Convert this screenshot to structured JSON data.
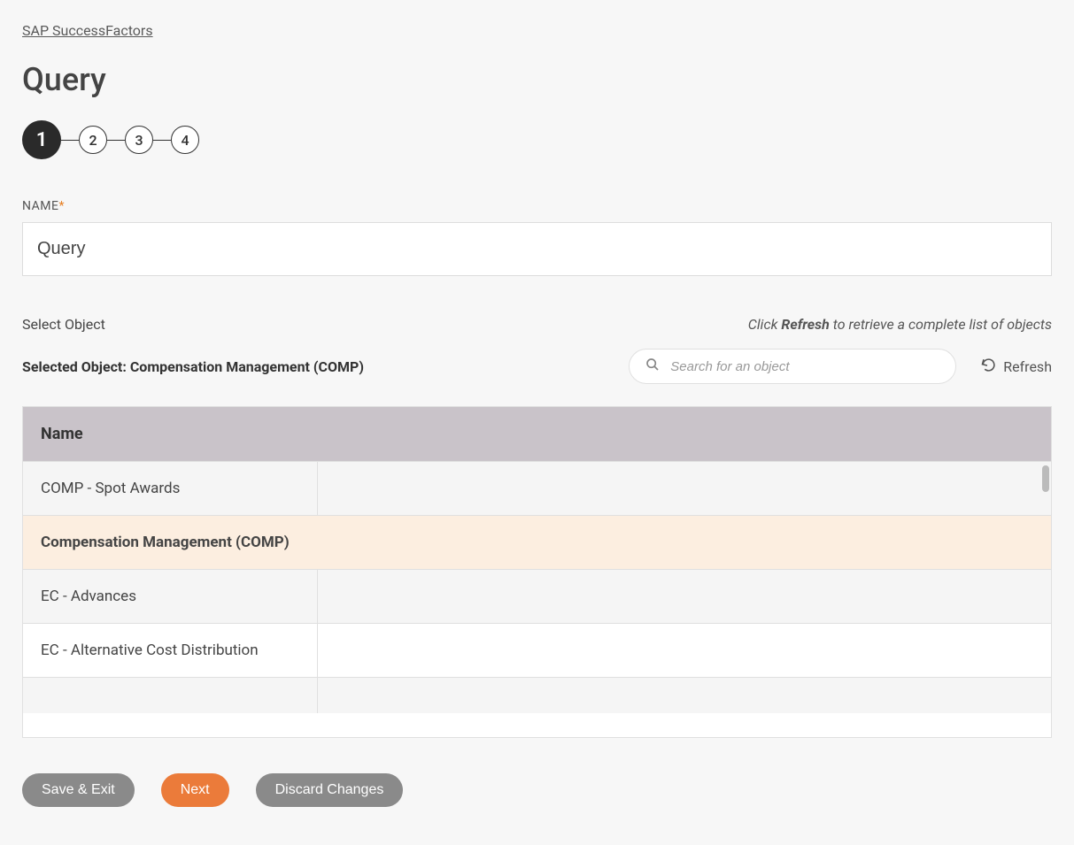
{
  "breadcrumb": "SAP SuccessFactors",
  "page_title": "Query",
  "stepper": {
    "steps": [
      "1",
      "2",
      "3",
      "4"
    ],
    "active_index": 0
  },
  "name_field": {
    "label": "NAME",
    "required_marker": "*",
    "value": "Query"
  },
  "select_object": {
    "label": "Select Object",
    "hint_prefix": "Click ",
    "hint_bold": "Refresh",
    "hint_suffix": " to retrieve a complete list of objects"
  },
  "selected_object": {
    "prefix": "Selected Object: ",
    "value": "Compensation Management (COMP)"
  },
  "search": {
    "placeholder": "Search for an object"
  },
  "refresh_label": "Refresh",
  "table": {
    "header": "Name",
    "rows": [
      {
        "name": "COMP - Spot Awards",
        "alt": true,
        "selected": false
      },
      {
        "name": "Compensation Management (COMP)",
        "alt": false,
        "selected": true
      },
      {
        "name": "EC - Advances",
        "alt": true,
        "selected": false
      },
      {
        "name": "EC - Alternative Cost Distribution",
        "alt": false,
        "selected": false
      },
      {
        "name": "",
        "alt": true,
        "selected": false
      }
    ]
  },
  "buttons": {
    "save_exit": "Save & Exit",
    "next": "Next",
    "discard": "Discard Changes"
  }
}
